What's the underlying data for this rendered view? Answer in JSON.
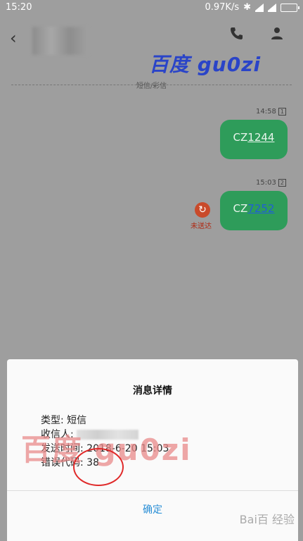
{
  "status_bar": {
    "time": "15:20",
    "speed": "0.97K/s"
  },
  "watermark_top": "百度 gu0zi",
  "divider_label": "短信/彩信",
  "messages": [
    {
      "time": "14:58",
      "sim": "1",
      "text_prefix": "CZ",
      "text_rest": "1244"
    },
    {
      "time": "15:03",
      "sim": "2",
      "text_prefix": "CZ",
      "text_rest": "7252",
      "status": "未送达"
    }
  ],
  "dialog": {
    "title": "消息详情",
    "type_label": "类型: 短信",
    "recipient_label": "收信人: ",
    "send_time": "发送时间: 2018-6-20 15:03",
    "error_code": "错误代码: 38",
    "ok": "确定"
  },
  "watermark_bottom": "百度 gu0zi",
  "baidu_mark": "Bai百 经验",
  "colors": {
    "bubble": "#2e9c5a",
    "accent": "#2a8fd6",
    "failed": "#c94a2a"
  }
}
